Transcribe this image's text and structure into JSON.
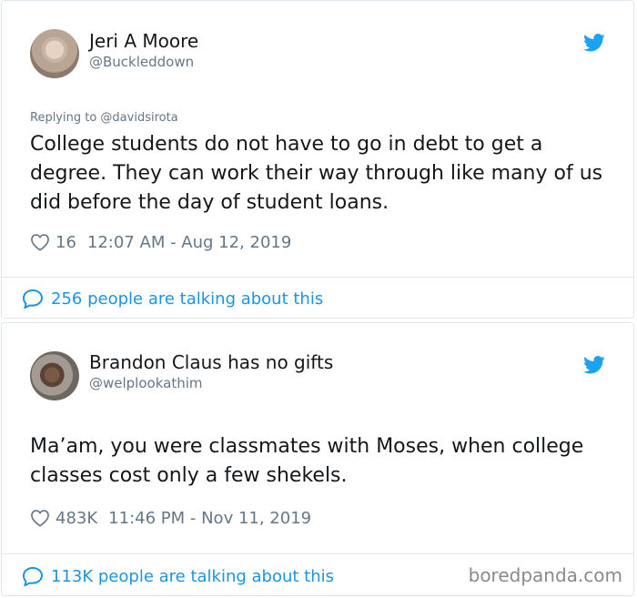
{
  "tweets": [
    {
      "name": "Jeri A Moore",
      "handle": "@Buckleddown",
      "replying_to": "Replying to @davidsirota",
      "text": "College students do not have to go in debt to get a degree. They can work their way through like many of us did before the day of student loans.",
      "likes": "16",
      "timestamp": "12:07 AM - Aug 12, 2019",
      "talking": "256 people are talking about this"
    },
    {
      "name": "Brandon Claus has no gifts",
      "handle": "@welplookathim",
      "text": "Ma’am, you were classmates with Moses, when college classes cost only a few shekels.",
      "likes": "483K",
      "timestamp": "11:46 PM - Nov 11, 2019",
      "talking": "113K people are talking about this"
    }
  ],
  "watermark": "boredpanda.com",
  "colors": {
    "twitter_blue": "#1da1f2",
    "link_blue": "#1b95e0",
    "text": "#14171a",
    "muted": "#657786",
    "border": "#e1e8ed"
  },
  "icons": {
    "brand": "twitter-bird-icon",
    "like": "heart-icon",
    "conversation": "speech-bubble-icon"
  }
}
